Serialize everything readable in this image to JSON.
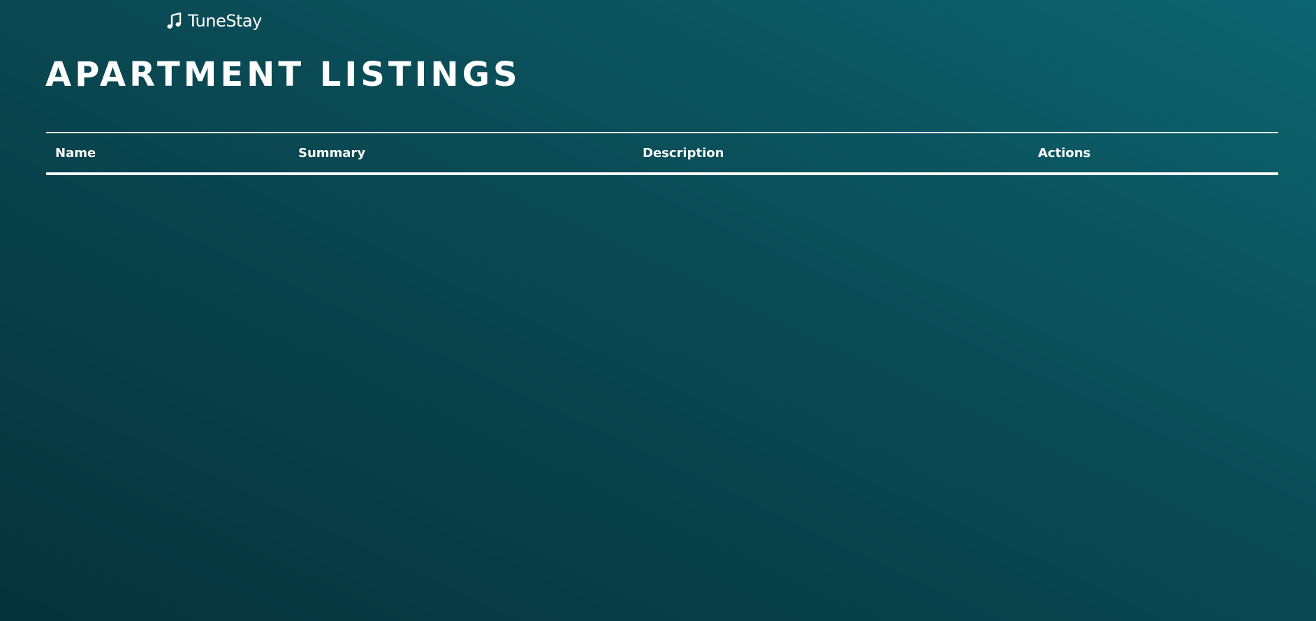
{
  "brand": {
    "name": "TuneStay",
    "icon": "music-note-icon"
  },
  "page": {
    "title": "APARTMENT LISTINGS"
  },
  "table": {
    "columns": {
      "name": "Name",
      "summary": "Summary",
      "description": "Description",
      "actions": "Actions"
    },
    "rows": []
  },
  "colors": {
    "background_dark": "#06323a",
    "background_light": "#0c6470",
    "text": "#ffffff"
  }
}
